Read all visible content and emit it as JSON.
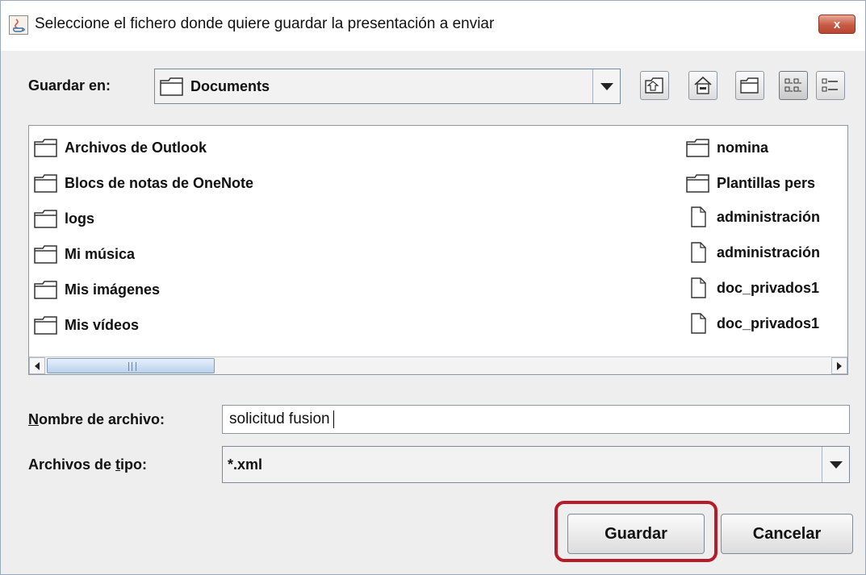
{
  "window": {
    "title": "Seleccione el fichero donde quiere guardar la presentación a enviar",
    "close_label": "x"
  },
  "lookin": {
    "label": "Guardar en:",
    "value": "Documents"
  },
  "toolbar": {
    "buttons": [
      "up-folder-icon",
      "home-icon",
      "new-folder-icon",
      "list-view-icon",
      "details-view-icon"
    ]
  },
  "files": {
    "left": [
      {
        "name": "Archivos de Outlook",
        "icon": "folder-icon"
      },
      {
        "name": "Blocs de notas de OneNote",
        "icon": "folder-icon"
      },
      {
        "name": "logs",
        "icon": "folder-icon"
      },
      {
        "name": "Mi música",
        "icon": "folder-icon"
      },
      {
        "name": "Mis imágenes",
        "icon": "folder-icon"
      },
      {
        "name": "Mis vídeos",
        "icon": "folder-icon"
      }
    ],
    "right": [
      {
        "name": "nomina",
        "icon": "folder-icon"
      },
      {
        "name": "Plantillas pers",
        "icon": "folder-icon"
      },
      {
        "name": "administración",
        "icon": "file-icon"
      },
      {
        "name": "administración",
        "icon": "file-icon"
      },
      {
        "name": "doc_privados1",
        "icon": "file-icon"
      },
      {
        "name": "doc_privados1",
        "icon": "file-icon"
      }
    ]
  },
  "filename": {
    "label_prefix": "",
    "label_underlined": "N",
    "label_rest": "ombre de archivo:",
    "value": "solicitud fusion"
  },
  "filetype": {
    "label_prefix": "Archivos de ",
    "label_underlined": "t",
    "label_rest": "ipo:",
    "value": "*.xml"
  },
  "actions": {
    "save": "Guardar",
    "cancel": "Cancelar"
  },
  "colors": {
    "highlight": "#b51c28",
    "close_button": "#c75a45"
  }
}
